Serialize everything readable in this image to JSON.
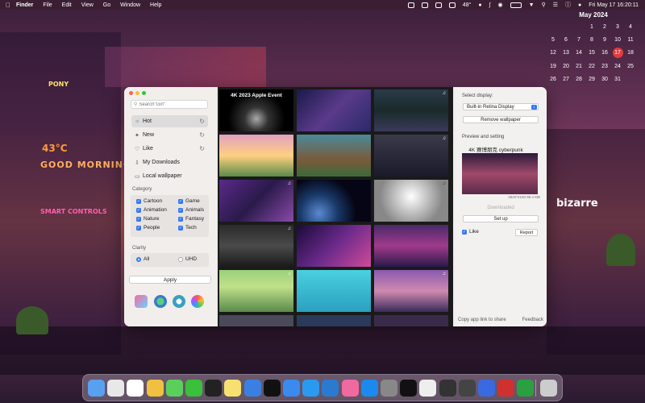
{
  "menubar": {
    "apple": "",
    "items": [
      "Finder",
      "File",
      "Edit",
      "View",
      "Go",
      "Window",
      "Help"
    ],
    "temperature": "48°",
    "datetime": "Fri May 17  16:20:11"
  },
  "calendar": {
    "month_title": "May 2024",
    "weekdays": [
      "S",
      "M",
      "T",
      "W",
      "T",
      "F",
      "S"
    ],
    "days": [
      "",
      "",
      "",
      "1",
      "2",
      "3",
      "4",
      "5",
      "6",
      "7",
      "8",
      "9",
      "10",
      "11",
      "12",
      "13",
      "14",
      "15",
      "16",
      "17",
      "18",
      "19",
      "20",
      "21",
      "22",
      "23",
      "24",
      "25",
      "26",
      "27",
      "28",
      "29",
      "30",
      "31",
      ""
    ],
    "today": "17"
  },
  "desktop": {
    "temp_text": "43°C",
    "morning_text": "GOOD MORNING",
    "smart_text": "SMART CONTROLS",
    "bizarre_text": "bizarre",
    "pony_text": "PONY"
  },
  "app": {
    "search_placeholder": "Search\"Girl\"",
    "nav": [
      {
        "label": "Hot",
        "icon": "sun-icon"
      },
      {
        "label": "New",
        "icon": "sparkle-icon"
      },
      {
        "label": "Like",
        "icon": "heart-icon"
      },
      {
        "label": "My Downloads",
        "icon": "download-icon"
      },
      {
        "label": "Local wallpaper",
        "icon": "monitor-icon"
      }
    ],
    "category_label": "Category",
    "categories": [
      "Cartoon",
      "Game",
      "Animation",
      "Animals",
      "Nature",
      "Fantasy",
      "People",
      "Tech"
    ],
    "clarity_label": "Clarity",
    "clarity_options": [
      "All",
      "UHD"
    ],
    "apply_label": "Apply",
    "grid_caption": "4K 2023 Apple Event",
    "right": {
      "select_display_label": "Select display:",
      "display_value": "Built-in Retina Display",
      "remove_label": "Remove wallpaper",
      "preview_label": "Preview and setting",
      "preview_title": "4K 赛博朋克 cyberpunk",
      "preview_meta": "3840*2160  98.4 MB",
      "downloaded_label": "Downloaded",
      "setup_label": "Set up",
      "like_label": "Like",
      "report_label": "Report",
      "copy_link_label": "Copy app link to share",
      "feedback_label": "Feedback"
    }
  },
  "dock": {
    "icons": [
      "finder-icon",
      "launchpad-icon",
      "calendar-icon",
      "chrome-icon",
      "messages-icon",
      "wechat-icon",
      "github-icon",
      "notes-icon",
      "xcode-icon",
      "terminal-icon",
      "mail-icon",
      "safari-icon",
      "vscode-icon",
      "photos-icon",
      "appstore-icon",
      "settings-icon",
      "activity-icon",
      "editor-icon",
      "piano-icon",
      "console-icon",
      "browser-icon",
      "wps-icon",
      "hbuilder-icon",
      "trash-icon"
    ]
  }
}
